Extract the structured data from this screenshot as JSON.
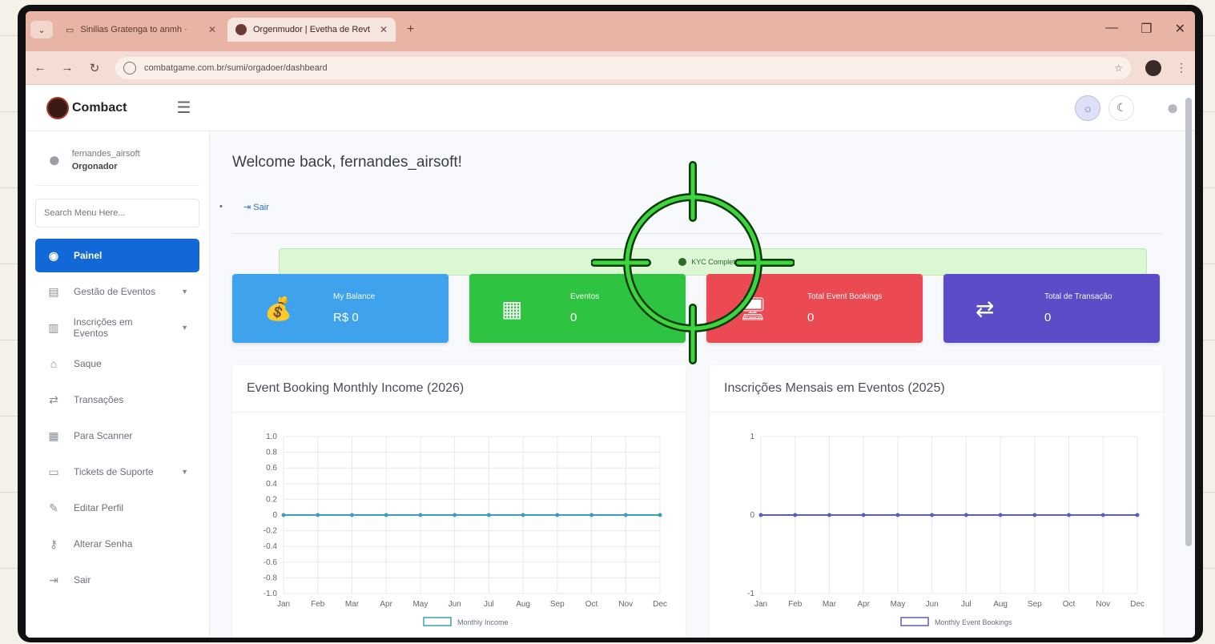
{
  "browser": {
    "tabs": [
      {
        "label": "Sinilias Gratenga to anmh ·"
      },
      {
        "label": "Orgenmudor | Evetha de Revt"
      }
    ],
    "url": "combatgame.com.br/sumi/orgadoer/dashbeard"
  },
  "header": {
    "logo_text": "Combact",
    "theme_light_icon": "sun-icon",
    "theme_dark_icon": "moon-icon"
  },
  "sidebar": {
    "username": "fernandes_airsoft",
    "role": "Orgonador",
    "search_placeholder": "Search Menu Here...",
    "items": [
      {
        "label": "Painel",
        "icon": "gauge-icon",
        "active": true
      },
      {
        "label": "Gestão de Eventos",
        "icon": "calendar-icon",
        "caret": true
      },
      {
        "label": "Inscrições em Eventos",
        "icon": "list-icon",
        "caret": true
      },
      {
        "label": "Saque",
        "icon": "bank-icon"
      },
      {
        "label": "Transações",
        "icon": "exchange-icon"
      },
      {
        "label": "Para Scanner",
        "icon": "qr-icon"
      },
      {
        "label": "Tickets de Suporte",
        "icon": "ticket-icon",
        "caret": true
      },
      {
        "label": "Editar Perfil",
        "icon": "user-edit-icon"
      },
      {
        "label": "Alterar Senha",
        "icon": "key-icon"
      },
      {
        "label": "Sair",
        "icon": "logout-icon"
      }
    ]
  },
  "main": {
    "welcome": "Welcome back, fernandes_airsoft!",
    "breadcrumb": "Sair",
    "alert": "KYC Completado",
    "cards": [
      {
        "label": "My Balance",
        "value": "R$ 0",
        "color": "#3ea3ec",
        "icon": "money-bag-icon"
      },
      {
        "label": "Eventos",
        "value": "0",
        "color": "#2fc342",
        "icon": "calendar-icon"
      },
      {
        "label": "Total Event Bookings",
        "value": "0",
        "color": "#ec4a53",
        "icon": "monitor-icon"
      },
      {
        "label": "Total de Transação",
        "value": "0",
        "color": "#5c4cc7",
        "icon": "transfer-icon"
      }
    ]
  },
  "chart_data": [
    {
      "type": "line",
      "title": "Event Booking Monthly Income (2026)",
      "categories": [
        "Jan",
        "Feb",
        "Mar",
        "Apr",
        "May",
        "Jun",
        "Jul",
        "Aug",
        "Sep",
        "Oct",
        "Nov",
        "Dec"
      ],
      "y_ticks": [
        "1.0",
        "0.8",
        "0.6",
        "0.4",
        "0.2",
        "0",
        "-0.2",
        "-0.4",
        "-0.6",
        "-0.8",
        "-1.0"
      ],
      "ylim": [
        -1,
        1
      ],
      "series": [
        {
          "name": "Monthly Income",
          "values": [
            0,
            0,
            0,
            0,
            0,
            0,
            0,
            0,
            0,
            0,
            0,
            0
          ],
          "color": "#3aa0b8"
        }
      ],
      "grid": true,
      "legend": "bottom"
    },
    {
      "type": "line",
      "title": "Inscrições Mensais em Eventos (2025)",
      "categories": [
        "Jan",
        "Feb",
        "Mar",
        "Apr",
        "May",
        "Jun",
        "Jul",
        "Aug",
        "Sep",
        "Oct",
        "Nov",
        "Dec"
      ],
      "y_ticks": [
        "1",
        "0",
        "-1"
      ],
      "ylim": [
        -1,
        1
      ],
      "series": [
        {
          "name": "Monthly Event Bookings",
          "values": [
            0,
            0,
            0,
            0,
            0,
            0,
            0,
            0,
            0,
            0,
            0,
            0
          ],
          "color": "#5a5fb8"
        }
      ],
      "grid": true,
      "legend": "bottom"
    }
  ]
}
